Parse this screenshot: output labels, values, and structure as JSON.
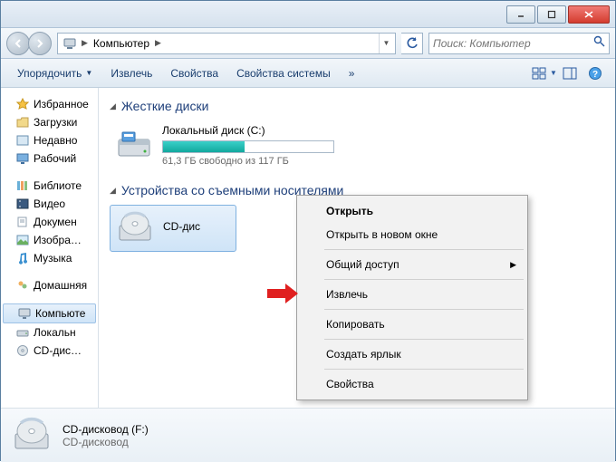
{
  "address": {
    "location": "Компьютер"
  },
  "search": {
    "placeholder": "Поиск: Компьютер"
  },
  "toolbar": {
    "organize": "Упорядочить",
    "eject": "Извлечь",
    "properties": "Свойства",
    "system_properties": "Свойства системы"
  },
  "sidebar": {
    "favorites": {
      "label": "Избранное",
      "items": [
        "Загрузки",
        "Недавно",
        "Рабочий"
      ]
    },
    "libraries": {
      "label": "Библиоте",
      "items": [
        "Видео",
        "Докумен",
        "Изобра…",
        "Музыка"
      ]
    },
    "homegroup": {
      "label": "Домашняя"
    },
    "computer": {
      "label": "Компьюте",
      "items": [
        "Локальн",
        "CD-дис…"
      ]
    }
  },
  "content": {
    "section_hdd": "Жесткие диски",
    "section_removable": "Устройства со съемными носителями",
    "local_disk": {
      "name": "Локальный диск (C:)",
      "free_text": "61,3 ГБ свободно из 117 ГБ",
      "used_percent": 48
    },
    "cd_drive": {
      "name": "CD-дис"
    }
  },
  "context_menu": {
    "open": "Открыть",
    "open_new": "Открыть в новом окне",
    "share": "Общий доступ",
    "eject": "Извлечь",
    "copy": "Копировать",
    "shortcut": "Создать ярлык",
    "properties": "Свойства"
  },
  "details": {
    "name": "CD-дисковод (F:)",
    "type": "CD-дисковод"
  }
}
